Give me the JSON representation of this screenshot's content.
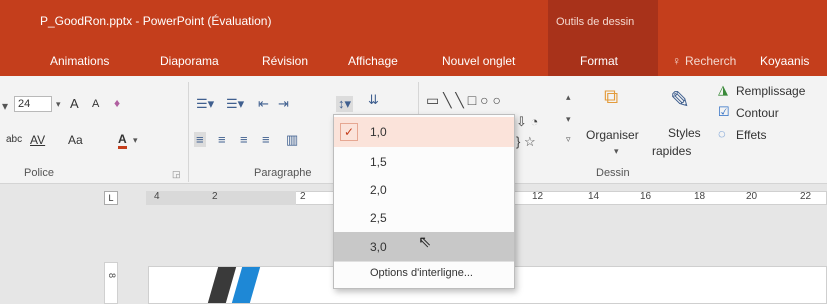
{
  "titlebar": {
    "app_title": "P_GoodRon.pptx - PowerPoint (Évaluation)",
    "contextual_header": "Outils de dessin",
    "user": "Koyaanis"
  },
  "tabs": [
    "Animations",
    "Diaporama",
    "Révision",
    "Affichage",
    "Nouvel onglet",
    "Format"
  ],
  "tell_me": "Recherch",
  "ribbon": {
    "font": {
      "size": "24",
      "grow": "A",
      "shrink": "A",
      "spacing": "AV",
      "case": "Aa",
      "color": "A",
      "strike": "abc",
      "group_label": "Police"
    },
    "paragraph": {
      "group_label": "Paragraphe",
      "line_spacing_icon": "line-spacing-icon"
    },
    "drawing": {
      "arrange": "Organiser",
      "styles": "Styles",
      "styles_sub": "rapides",
      "fill": "Remplissage",
      "outline": "Contour",
      "effects": "Effets",
      "group_label": "Dessin"
    }
  },
  "ruler": {
    "numbers_left": [
      "4",
      "2",
      "2"
    ],
    "numbers_right": [
      "12",
      "14",
      "16",
      "18",
      "20",
      "22"
    ],
    "vertical": "8"
  },
  "line_spacing_menu": {
    "items": [
      "1,0",
      "1,5",
      "2,0",
      "2,5",
      "3,0"
    ],
    "selected": "1,0",
    "hovered": "3,0",
    "options_label": "Options d'interligne..."
  },
  "colors": {
    "title_bar": "#c43e1c",
    "contextual": "#a8321a",
    "selection": "#fbe3da",
    "hover": "#c8c8c8",
    "slide_stripe_blue": "#1e88d6",
    "slide_stripe_dark": "#3a3a3a"
  }
}
